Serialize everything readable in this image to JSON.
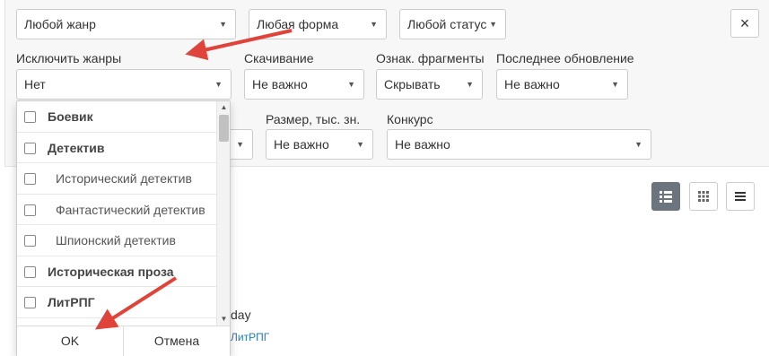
{
  "filters": {
    "genre": "Любой жанр",
    "form": "Любая форма",
    "status": "Любой статус",
    "exclude_label": "Исключить жанры",
    "exclude_value": "Нет",
    "download_label": "Скачивание",
    "download_value": "Не важно",
    "fragments_label": "Ознак. фрагменты",
    "fragments_value": "Скрывать",
    "updated_label": "Последнее обновление",
    "updated_value": "Не важно",
    "size_label": "Размер, тыс. зн.",
    "size_value": "Не важно",
    "contest_label": "Конкурс",
    "contest_value": "Не важно"
  },
  "close_label": "×",
  "dropdown": {
    "items": [
      {
        "label": "Боевик",
        "level": "group"
      },
      {
        "label": "Детектив",
        "level": "group"
      },
      {
        "label": "Исторический детектив",
        "level": "sub"
      },
      {
        "label": "Фантастический детектив",
        "level": "sub"
      },
      {
        "label": "Шпионский детектив",
        "level": "sub"
      },
      {
        "label": "Историческая проза",
        "level": "group"
      },
      {
        "label": "ЛитРПГ",
        "level": "group"
      }
    ],
    "ok_label": "OK",
    "cancel_label": "Отмена"
  },
  "background": {
    "day_text": "day",
    "genre_link": "ЛитРПГ"
  },
  "view_toggle": {
    "active": "list-detailed"
  },
  "colors": {
    "annotation_arrow": "#e0433a",
    "link": "#2a7ab0",
    "active_view": "#6c757d"
  }
}
